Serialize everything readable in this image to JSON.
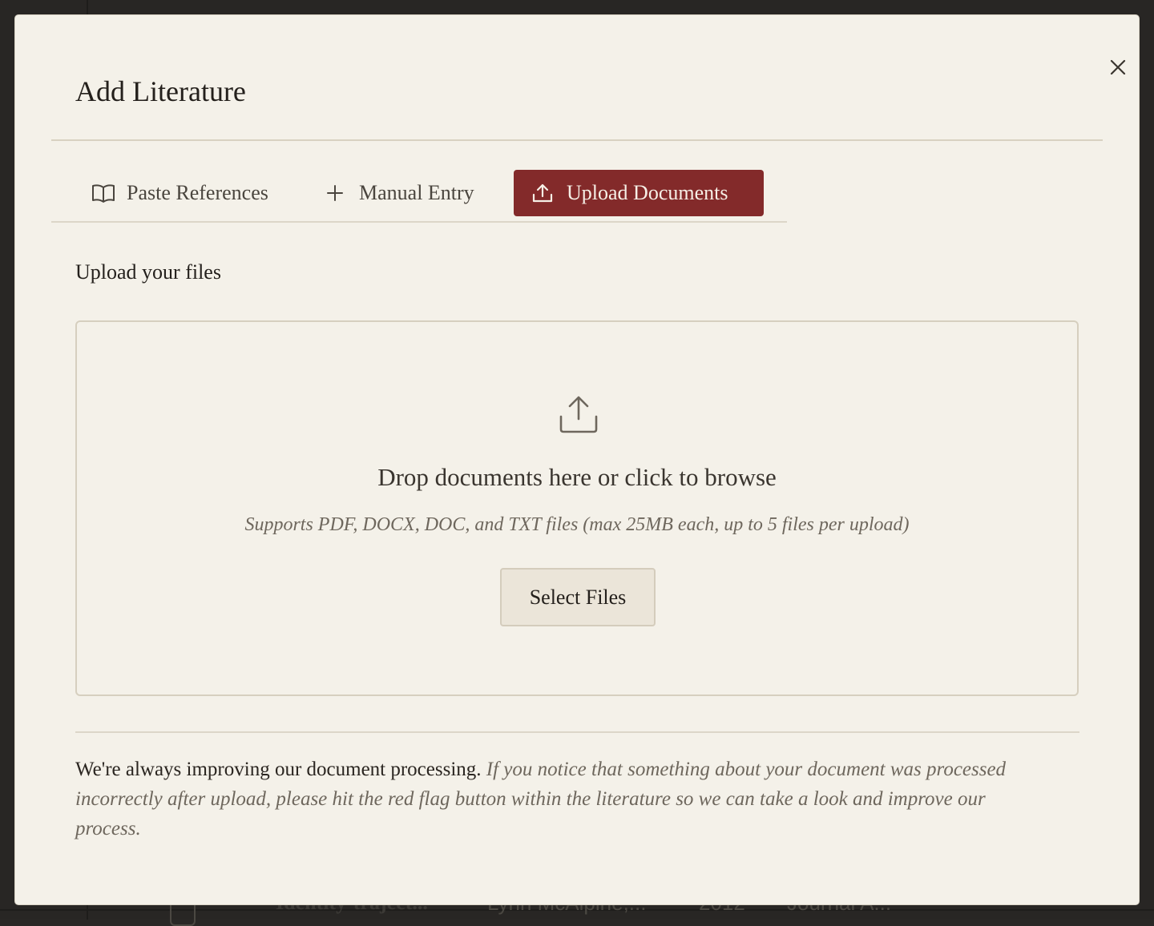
{
  "background": {
    "row_title": "Identity-traject...",
    "row_authors": "Lynn McAlpine,...",
    "row_year": "2012",
    "row_type": "Journal A..."
  },
  "modal": {
    "title": "Add Literature",
    "close_icon": "close-icon",
    "tabs": [
      {
        "label": "Paste References",
        "icon": "book-open-icon",
        "active": false
      },
      {
        "label": "Manual Entry",
        "icon": "plus-icon",
        "active": false
      },
      {
        "label": "Upload Documents",
        "icon": "upload-icon",
        "active": true
      }
    ],
    "section_label": "Upload your files",
    "dropzone": {
      "icon": "upload-icon",
      "title": "Drop documents here or click to browse",
      "subtitle": "Supports PDF, DOCX, DOC, and TXT files (max 25MB each, up to 5 files per upload)",
      "button_label": "Select Files"
    },
    "notice": {
      "lead": "We're always improving our document processing.",
      "body": "If you notice that something about your document was processed incorrectly after upload, please hit the red flag button within the literature so we can take a look and improve our process."
    }
  },
  "colors": {
    "accent": "#832a2a",
    "modal_bg": "#f4f1e9",
    "overlay": "#282624"
  }
}
